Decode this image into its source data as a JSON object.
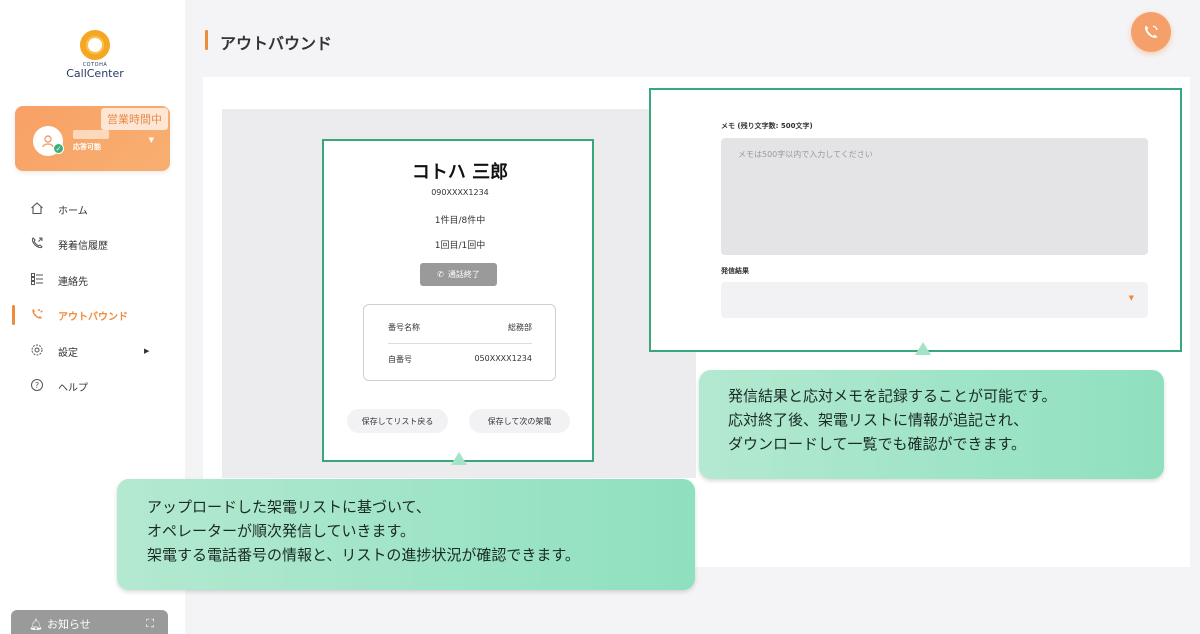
{
  "app": {
    "logo_small": "COTOHA",
    "logo_main": "CallCenter"
  },
  "user_card": {
    "badge": "営業時間中",
    "status": "応答可能"
  },
  "nav": {
    "items": [
      {
        "label": "ホーム",
        "icon": "home-icon"
      },
      {
        "label": "発着信履歴",
        "icon": "call-history-icon"
      },
      {
        "label": "連絡先",
        "icon": "contacts-icon"
      },
      {
        "label": "アウトバウンド",
        "icon": "outbound-icon",
        "active": true
      },
      {
        "label": "設定",
        "icon": "settings-icon"
      },
      {
        "label": "ヘルプ",
        "icon": "help-icon"
      }
    ]
  },
  "notice": {
    "label": "お知らせ"
  },
  "header": {
    "title": "アウトバウンド"
  },
  "contact": {
    "name": "コトハ 三郎",
    "phone": "090XXXX1234",
    "list_progress": "1件目/8件中",
    "call_progress": "1回目/1回中",
    "end_call_label": "通話終了",
    "info": [
      {
        "key": "番号名称",
        "value": "総務部"
      },
      {
        "key": "自番号",
        "value": "050XXXX1234"
      }
    ],
    "save_back_label": "保存してリスト戻る",
    "save_next_label": "保存して次の架電"
  },
  "memo": {
    "label": "メモ (残り文字数: 500文字)",
    "placeholder": "メモは500字以内で入力してください"
  },
  "result": {
    "label": "発信結果",
    "value": ""
  },
  "callouts": {
    "left": [
      "アップロードした架電リストに基づいて、",
      "オペレーターが順次発信していきます。",
      "架電する電話番号の情報と、リストの進捗状況が確認できます。"
    ],
    "right": [
      "発信結果と応対メモを記録することが可能です。",
      "応対終了後、架電リストに情報が追記され、",
      "ダウンロードして一覧でも確認ができます。"
    ]
  },
  "colors": {
    "accent": "#f08a3c",
    "highlight_border": "#3aa67b",
    "callout_bg": "#a3e4c8"
  }
}
